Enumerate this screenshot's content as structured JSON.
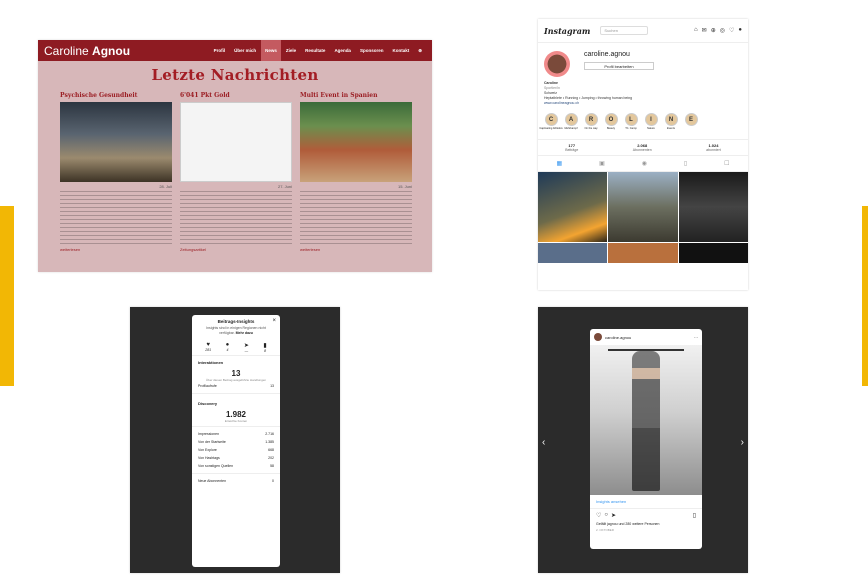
{
  "website": {
    "logo_first": "Caroline",
    "logo_last": "Agnou",
    "menu": [
      "Profil",
      "Über mich",
      "News",
      "Ziele",
      "Resultate",
      "Agenda",
      "Sponsoren",
      "Kontakt",
      "⊕"
    ],
    "active_menu": "News",
    "title": "Letzte Nachrichten",
    "columns": [
      {
        "heading": "Psychische Gesundheit",
        "date": "28. Juli",
        "more": "weiterlesen"
      },
      {
        "heading": "6'041 Pkt Gold",
        "date": "27. Juni",
        "more": "Zeitungsartikel"
      },
      {
        "heading": "Multi Event in Spanien",
        "date": "15. Juni",
        "more": "weiterlesen"
      }
    ]
  },
  "instagram": {
    "logo": "Instagram",
    "search_placeholder": "Suchen",
    "username": "caroline.agnou",
    "edit_button": "Profil bearbeiten",
    "bio_name": "Caroline",
    "bio_category": "Sportler/in",
    "bio_location": "Schweiz",
    "bio_text": "Heptathlete • Running • Jumping • throwing human being",
    "bio_link": "www.carolineagnou.ch",
    "highlights": [
      {
        "letter": "C",
        "label": "Captivating Athletics"
      },
      {
        "letter": "A",
        "label": "Mehrkampf"
      },
      {
        "letter": "R",
        "label": "On the way"
      },
      {
        "letter": "O",
        "label": "Beauty"
      },
      {
        "letter": "L",
        "label": "Trt. Camp"
      },
      {
        "letter": "I",
        "label": "Nature"
      },
      {
        "letter": "N",
        "label": "Events"
      },
      {
        "letter": "E",
        "label": ""
      }
    ],
    "stats": [
      {
        "value": "177",
        "label": "Beiträge"
      },
      {
        "value": "2.068",
        "label": "Abonnenten"
      },
      {
        "value": "1.024",
        "label": "abonniert"
      }
    ]
  },
  "insights": {
    "title": "Beitrags-Insights",
    "note_prefix": "Insights sind in einigen Regionen nicht verfügbar.",
    "note_link": "Mehr dazu",
    "icons": [
      {
        "glyph": "♥",
        "value": "281"
      },
      {
        "glyph": "●",
        "value": "4"
      },
      {
        "glyph": "➤",
        "value": "—"
      },
      {
        "glyph": "▮",
        "value": "8"
      }
    ],
    "interactions_label": "Interaktionen",
    "interactions_value": "13",
    "interactions_sub": "Über diesen Beitrag ausgeführte Handlungen",
    "profile_visits_label": "Profilaufrufe",
    "profile_visits_value": "13",
    "discovery_label": "Discovery",
    "discovery_value": "1.982",
    "discovery_sub": "Erreichte Konten",
    "rows": [
      {
        "label": "Impressionen",
        "value": "2.716"
      },
      {
        "label": "Von der Startseite",
        "value": "1.385"
      },
      {
        "label": "Von Explore",
        "value": "668"
      },
      {
        "label": "Von Hashtags",
        "value": "202"
      },
      {
        "label": "Von sonstigen Quellen",
        "value": "58"
      }
    ],
    "follows_label": "Neue Abonnenten",
    "follows_value": "0"
  },
  "post": {
    "username": "caroline.agnou",
    "insights_link": "Insights ansehen",
    "likes": "Gefällt jagnou und 280 weitere Personen",
    "time": "2. OKTOBER"
  }
}
